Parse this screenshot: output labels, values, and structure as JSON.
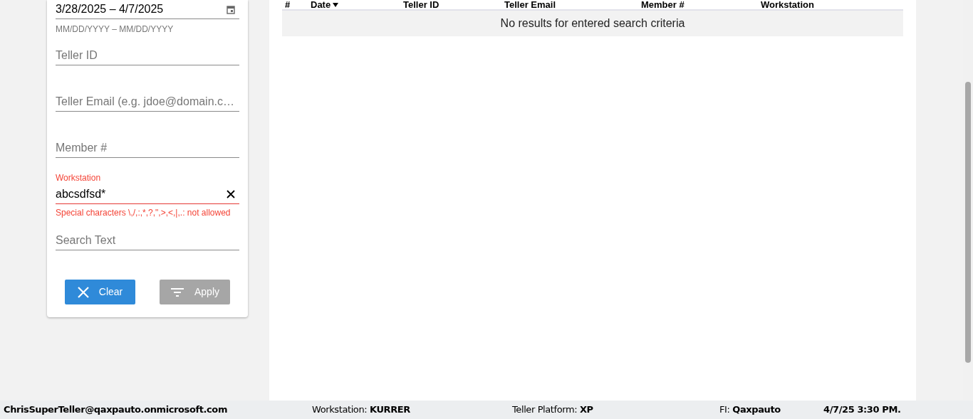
{
  "filters": {
    "date_range": {
      "value": "3/28/2025 – 4/7/2025",
      "hint": "MM/DD/YYYY – MM/DD/YYYY"
    },
    "fields": [
      {
        "placeholder": "Teller ID"
      },
      {
        "placeholder": "Teller Email (e.g. jdoe@domain.c…"
      },
      {
        "placeholder": "Member #"
      },
      {
        "label": "Workstation",
        "value": "abcsdfsd*",
        "error": "Special characters \\,/,:,*,?,\",>,<,|,.: not allowed"
      },
      {
        "placeholder": "Search Text"
      }
    ],
    "buttons": [
      {
        "label": "Clear",
        "kind": "clear",
        "disabled": false
      },
      {
        "label": "Apply",
        "kind": "apply",
        "disabled": true
      }
    ]
  },
  "table": {
    "columns": [
      {
        "label": "#"
      },
      {
        "label": "Date",
        "sorted": true
      },
      {
        "label": "Teller ID"
      },
      {
        "label": "Teller Email"
      },
      {
        "label": "Member #"
      },
      {
        "label": "Workstation"
      }
    ],
    "empty_message": "No results for entered search criteria"
  },
  "status_bar": {
    "user": "ChrisSuperTeller@qaxpauto.onmicrosoft.com",
    "items": [
      {
        "label": "Workstation:",
        "value": "KURRER"
      },
      {
        "label": "Teller Platform:",
        "value": "XP"
      },
      {
        "label": "FI:",
        "value": "Qaxpauto"
      }
    ],
    "datetime": "4/7/25 3:30 PM."
  }
}
